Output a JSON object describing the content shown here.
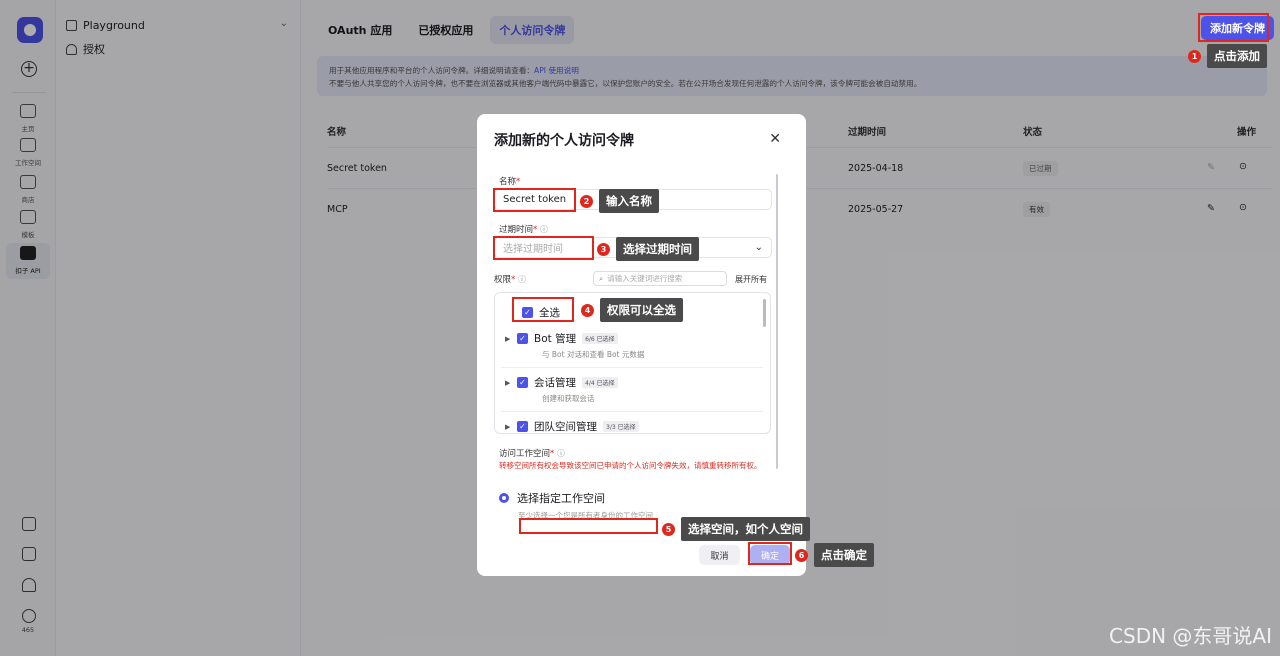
{
  "rail": {
    "nav": [
      {
        "label": "主页",
        "icon": "home-icon"
      },
      {
        "label": "工作空间",
        "icon": "terminal-icon"
      },
      {
        "label": "商店",
        "icon": "store-icon"
      },
      {
        "label": "模板",
        "icon": "template-icon"
      },
      {
        "label": "扣子 API",
        "icon": "api-icon"
      }
    ],
    "count": "465"
  },
  "sidebar": {
    "title": "Playground",
    "item": "授权"
  },
  "tabs": [
    "OAuth 应用",
    "已授权应用",
    "个人访问令牌"
  ],
  "add_button": "添加新令牌",
  "notice": {
    "line1": "用于其他应用程序和平台的个人访问令牌。详细说明请查看：",
    "link": "API 使用说明",
    "line2": "不要与他人共享您的个人访问令牌，也不要在浏览器或其他客户端代码中暴露它，以保护您账户的安全。若在公开场合发现任何泄露的个人访问令牌，该令牌可能会被自动禁用。"
  },
  "table": {
    "headers": {
      "name": "名称",
      "expire": "过期时间",
      "status": "状态",
      "action": "操作"
    },
    "rows": [
      {
        "name": "Secret token",
        "expire": "2025-04-18",
        "status": "已过期"
      },
      {
        "name": "MCP",
        "expire": "2025-05-27",
        "status": "有效"
      }
    ]
  },
  "modal": {
    "title": "添加新的个人访问令牌",
    "name_label": "名称",
    "name_value": "Secret token",
    "expire_label": "过期时间",
    "expire_placeholder": "选择过期时间",
    "perm_label": "权限",
    "search_placeholder": "请输入关键词进行搜索",
    "expand_all": "展开所有",
    "select_all": "全选",
    "permissions": [
      {
        "name": "Bot 管理",
        "count": "6/6 已选择",
        "desc": "与 Bot 对话和查看 Bot 元数据"
      },
      {
        "name": "会话管理",
        "count": "4/4 已选择",
        "desc": "创建和获取会话"
      },
      {
        "name": "团队空间管理",
        "count": "3/3 已选择",
        "desc": ""
      }
    ],
    "workspace_label": "访问工作空间",
    "workspace_warning": "转移空间所有权会导致该空间已申请的个人访问令牌失效，请慎重转移所有权。",
    "radio_label": "选择指定工作空间",
    "radio_hint": "至少选择一个您是所有者身份的工作空间",
    "cancel": "取消",
    "confirm": "确定"
  },
  "annotations": [
    {
      "num": "1",
      "text": "点击添加"
    },
    {
      "num": "2",
      "text": "输入名称"
    },
    {
      "num": "3",
      "text": "选择过期时间"
    },
    {
      "num": "4",
      "text": "权限可以全选"
    },
    {
      "num": "5",
      "text": "选择空间，如个人空间"
    },
    {
      "num": "6",
      "text": "点击确定"
    }
  ],
  "watermark": "CSDN @东哥说AI"
}
